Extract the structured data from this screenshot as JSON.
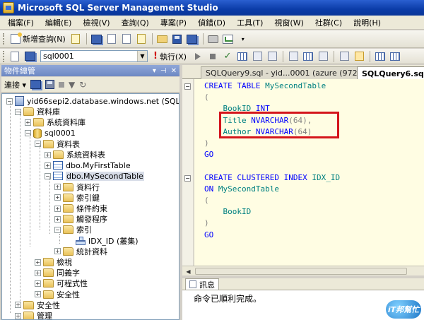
{
  "window": {
    "title": "Microsoft SQL Server Management Studio"
  },
  "menu": [
    "檔案(F)",
    "編輯(E)",
    "檢視(V)",
    "查詢(Q)",
    "專案(P)",
    "偵錯(D)",
    "工具(T)",
    "視窗(W)",
    "社群(C)",
    "說明(H)"
  ],
  "toolbar": {
    "new_query_label": "新增查詢(N)"
  },
  "toolbar2": {
    "database": "sql0001",
    "execute_label": "執行(X)"
  },
  "object_explorer": {
    "title": "物件總管",
    "connect_label": "連接",
    "tree": [
      {
        "label": "yid66sepi2.database.windows.net (SQL Se",
        "icon": "server-icon",
        "expander": "−"
      },
      {
        "label": "資料庫",
        "icon": "folder-icon",
        "expander": "−"
      },
      {
        "label": "系統資料庫",
        "icon": "folder-icon",
        "expander": "+"
      },
      {
        "label": "sql0001",
        "icon": "database-icon",
        "expander": "−"
      },
      {
        "label": "資料表",
        "icon": "folder-icon",
        "expander": "−"
      },
      {
        "label": "系統資料表",
        "icon": "folder-icon",
        "expander": "+"
      },
      {
        "label": "dbo.MyFirstTable",
        "icon": "table-icon",
        "expander": "+"
      },
      {
        "label": "dbo.MySecondTable",
        "icon": "table-icon",
        "expander": "−",
        "selected": true
      },
      {
        "label": "資料行",
        "icon": "folder-icon",
        "expander": "+"
      },
      {
        "label": "索引鍵",
        "icon": "folder-icon",
        "expander": "+"
      },
      {
        "label": "條件約束",
        "icon": "folder-icon",
        "expander": "+"
      },
      {
        "label": "觸發程序",
        "icon": "folder-icon",
        "expander": "+"
      },
      {
        "label": "索引",
        "icon": "folder-icon",
        "expander": "−"
      },
      {
        "label": "IDX_ID (叢集)",
        "icon": "index-icon",
        "expander": ""
      },
      {
        "label": "統計資料",
        "icon": "folder-icon",
        "expander": "+"
      },
      {
        "label": "檢視",
        "icon": "folder-icon",
        "expander": "+"
      },
      {
        "label": "同義字",
        "icon": "folder-icon",
        "expander": "+"
      },
      {
        "label": "可程式性",
        "icon": "folder-icon",
        "expander": "+"
      },
      {
        "label": "安全性",
        "icon": "folder-icon",
        "expander": "+"
      },
      {
        "label": "安全性",
        "icon": "folder-icon",
        "expander": "+"
      },
      {
        "label": "管理",
        "icon": "folder-icon",
        "expander": "+"
      }
    ]
  },
  "editor": {
    "tabs": [
      {
        "label": "SQLQuery9.sql - yid...0001 (azure (972))*",
        "active": false
      },
      {
        "label": "SQLQuery6.sql -",
        "active": true
      }
    ],
    "lines": [
      [
        {
          "t": "CREATE TABLE ",
          "c": "kw"
        },
        {
          "t": "MySecondTable",
          "c": "id"
        }
      ],
      [
        {
          "t": "(",
          "c": "gr"
        }
      ],
      [
        {
          "t": "    BookID ",
          "c": "id"
        },
        {
          "t": "INT",
          "c": "kw"
        }
      ],
      [
        {
          "t": "    Title ",
          "c": "id"
        },
        {
          "t": "NVARCHAR",
          "c": "kw"
        },
        {
          "t": "(64),",
          "c": "gr"
        }
      ],
      [
        {
          "t": "    Author ",
          "c": "id"
        },
        {
          "t": "NVARCHAR",
          "c": "kw"
        },
        {
          "t": "(64)",
          "c": "gr"
        }
      ],
      [
        {
          "t": ")",
          "c": "gr"
        }
      ],
      [
        {
          "t": "GO",
          "c": "kw"
        }
      ],
      [],
      [
        {
          "t": "CREATE CLUSTERED INDEX ",
          "c": "kw"
        },
        {
          "t": "IDX_ID",
          "c": "id"
        }
      ],
      [
        {
          "t": "ON ",
          "c": "kw"
        },
        {
          "t": "MySecondTable",
          "c": "id"
        }
      ],
      [
        {
          "t": "(",
          "c": "gr"
        }
      ],
      [
        {
          "t": "    BookID",
          "c": "id"
        }
      ],
      [
        {
          "t": ")",
          "c": "gr"
        }
      ],
      [
        {
          "t": "GO",
          "c": "kw"
        }
      ]
    ]
  },
  "messages": {
    "tab_label": "訊息",
    "text": "命令已順利完成。"
  },
  "watermark": "iT邦幫忙",
  "colors": {
    "keyword": "#0000ff",
    "identifier": "#008080",
    "punctuation": "#808080",
    "highlight_box": "#d4151b",
    "editor_bg": "#fffde3"
  }
}
